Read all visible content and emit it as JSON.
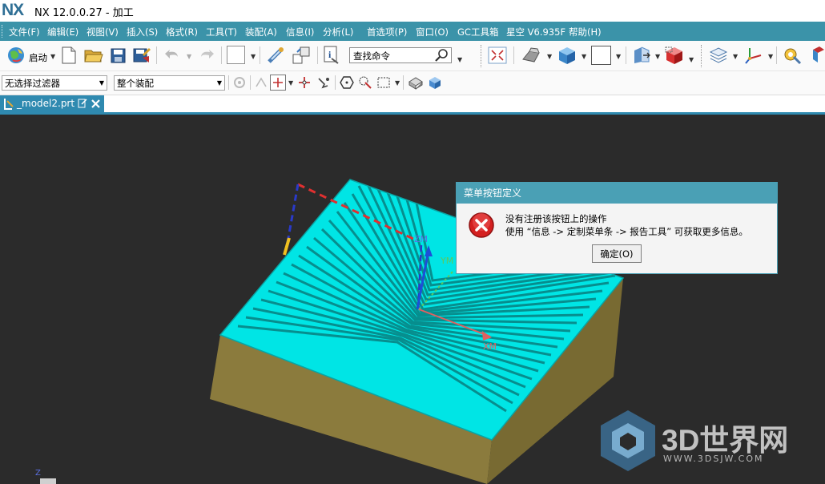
{
  "window": {
    "app_name": "NX",
    "title": "NX 12.0.0.27 - 加工"
  },
  "menubar": {
    "items": [
      "文件(F)",
      "编辑(E)",
      "视图(V)",
      "插入(S)",
      "格式(R)",
      "工具(T)",
      "装配(A)",
      "信息(I)",
      "分析(L)",
      "首选项(P)",
      "窗口(O)",
      "GC工具箱",
      "星空 V6.935F",
      "帮助(H)"
    ]
  },
  "toolbar": {
    "start_label": "启动",
    "search_placeholder": "查找命令"
  },
  "selection_bar": {
    "filter_value": "无选择过滤器",
    "scope_value": "整个装配"
  },
  "document_tab": {
    "label": "_model2.prt"
  },
  "viewport": {
    "axis_labels": {
      "zm": "ZM",
      "ym": "YM",
      "xm": "XM",
      "z": "Z"
    }
  },
  "dialog": {
    "title": "菜单按钮定义",
    "message_line1": "没有注册该按钮上的操作",
    "message_line2": "使用 “信息 -> 定制菜单条 -> 报告工具” 可获取更多信息。",
    "ok_label": "确定(O)"
  },
  "watermark": {
    "main": "3D世界网",
    "sub": "WWW.3DSJW.COM"
  },
  "colors": {
    "menubar_bg": "#3b93a9",
    "tab_bg": "#2f8ab0",
    "viewport_bg": "#2b2b2b",
    "part_top": "#00e5e5",
    "part_side": "#8b7b3d",
    "dialog_title_bg": "#4aa0b5",
    "error_red": "#d42020"
  }
}
